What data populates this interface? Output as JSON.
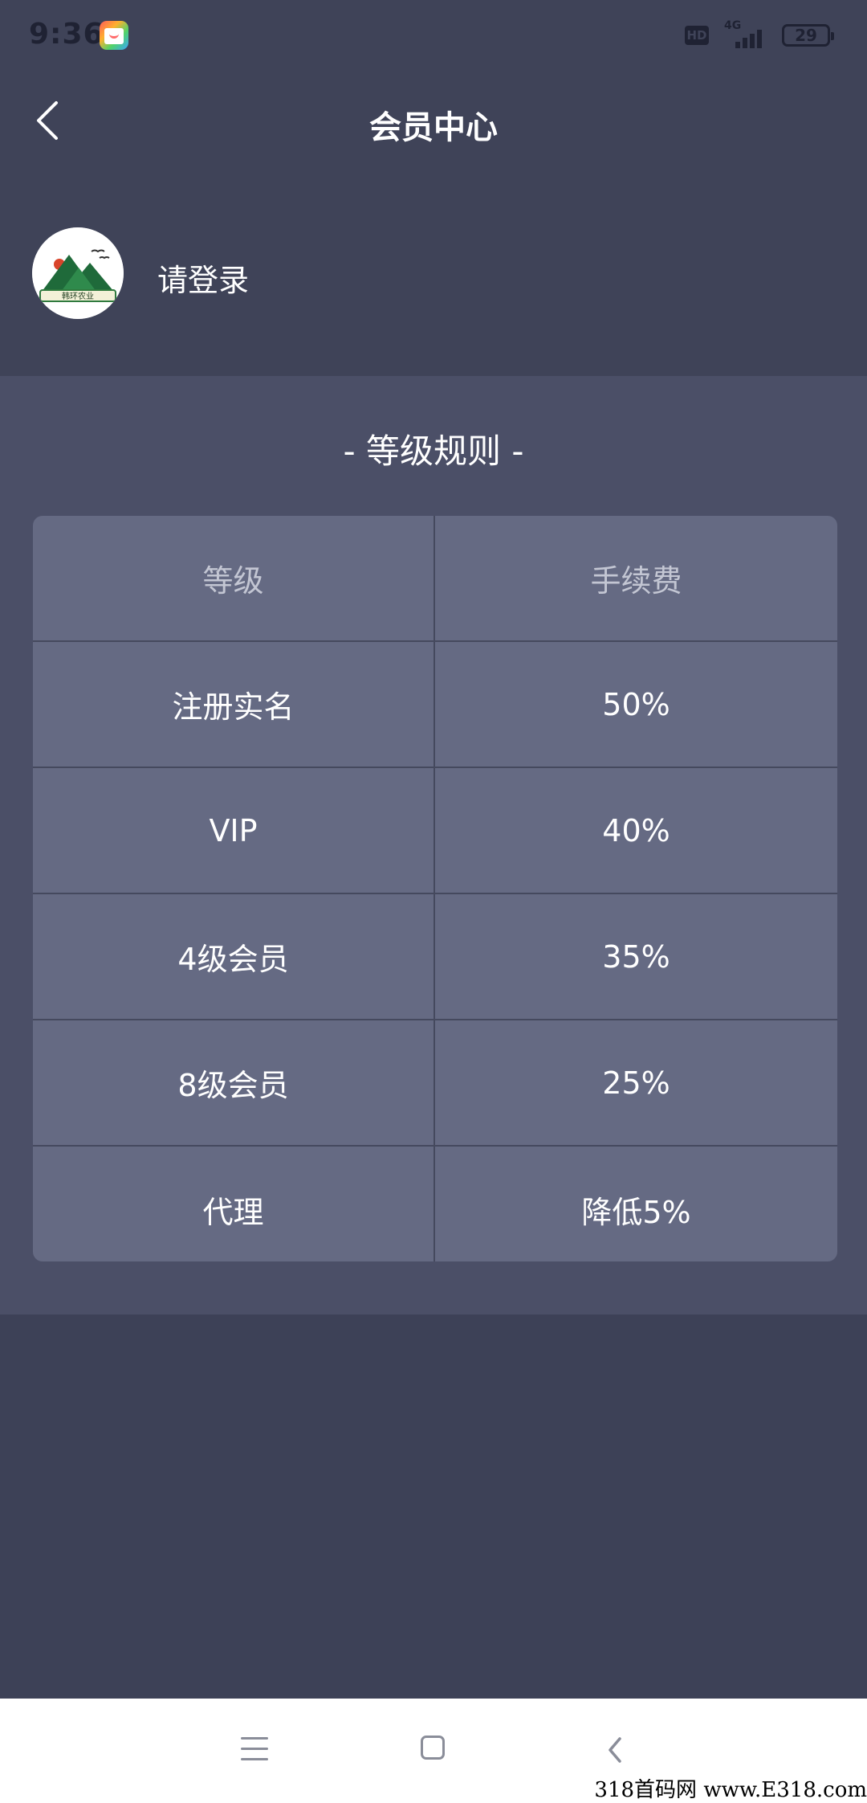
{
  "status_bar": {
    "time": "9:36",
    "hd": "HD",
    "network": "4G",
    "battery": "29"
  },
  "header": {
    "title": "会员中心",
    "login_text": "请登录",
    "avatar_caption": "韩环农业"
  },
  "rules": {
    "title": "- 等级规则 -",
    "columns": [
      "等级",
      "手续费"
    ],
    "rows": [
      {
        "level": "注册实名",
        "fee": "50%"
      },
      {
        "level": "VIP",
        "fee": "40%"
      },
      {
        "level": "4级会员",
        "fee": "35%"
      },
      {
        "level": "8级会员",
        "fee": "25%"
      },
      {
        "level": "代理",
        "fee": "降低5%"
      }
    ]
  },
  "watermark": "318首码网 www.E318.com"
}
